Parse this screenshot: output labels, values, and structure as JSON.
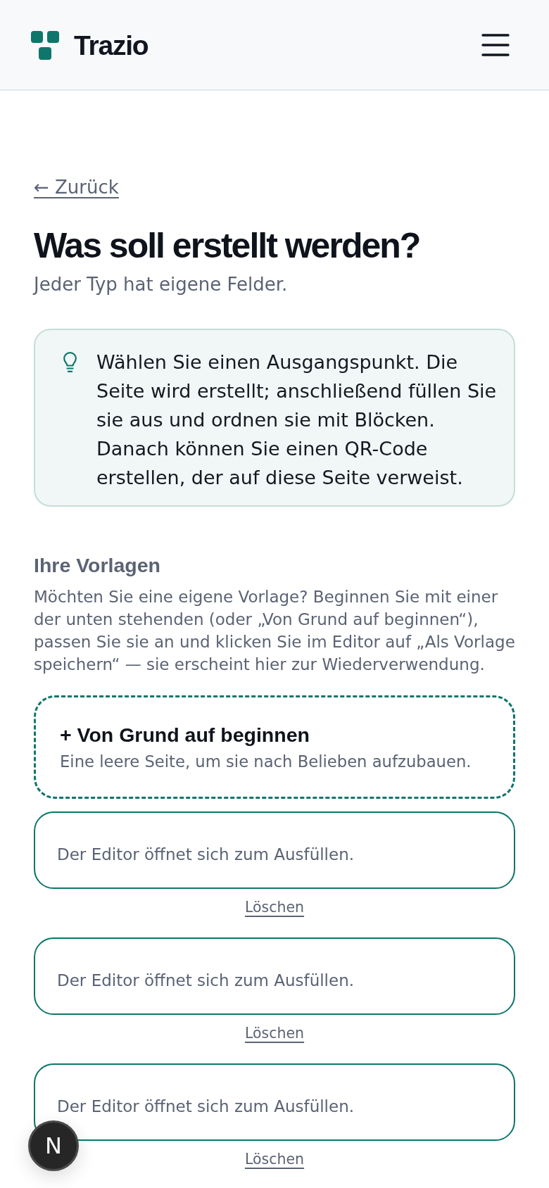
{
  "header": {
    "logo_text": "Trazio"
  },
  "back_link": "← Zurück",
  "title": "Was soll erstellt werden?",
  "subtitle": "Jeder Typ hat eigene Felder.",
  "tip": {
    "text": "Wählen Sie einen Ausgangspunkt. Die Seite wird erstellt; anschließend füllen Sie sie aus und ordnen sie mit Blöcken. Danach können Sie einen QR-Code erstellen, der auf diese Seite verweist."
  },
  "templates_section": {
    "heading": "Ihre Vorlagen",
    "description": "Möchten Sie eine eigene Vorlage? Beginnen Sie mit einer der unten stehenden (oder „Von Grund auf beginnen“), passen Sie sie an und klicken Sie im Editor auf „Als Vorlage speichern“ — sie erscheint hier zur Wiederverwendung.",
    "blank_option": {
      "title": "+ Von Grund auf beginnen",
      "description": "Eine leere Seite, um sie nach Belieben aufzubauen."
    },
    "templates": [
      {
        "description": "Der Editor öffnet sich zum Ausfüllen.",
        "delete_label": "Löschen"
      },
      {
        "description": "Der Editor öffnet sich zum Ausfüllen.",
        "delete_label": "Löschen"
      },
      {
        "description": "Der Editor öffnet sich zum Ausfüllen.",
        "delete_label": "Löschen"
      }
    ]
  },
  "dev_indicator": {
    "label": "N"
  }
}
